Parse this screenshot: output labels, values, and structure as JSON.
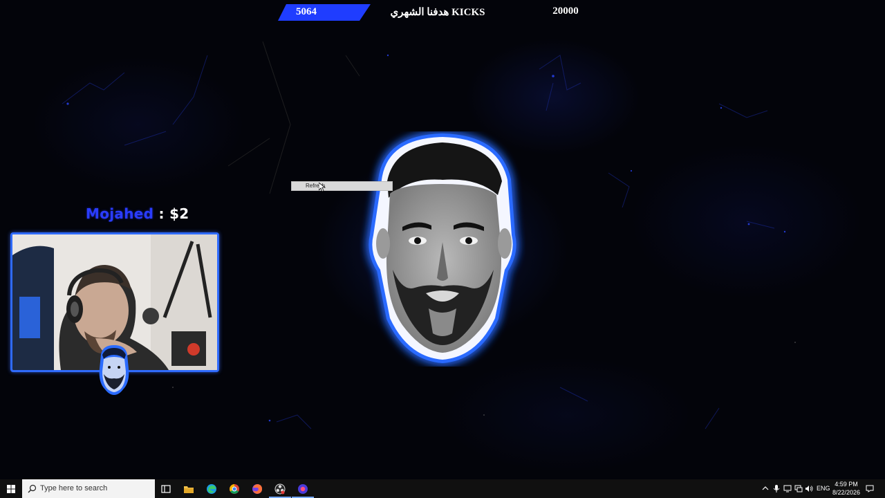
{
  "overlay": {
    "goal_current": "5064",
    "goal_title": "هدفنا الشهري KICKS",
    "goal_target": "20000",
    "accent_color": "#1f3dff"
  },
  "context_menu": {
    "item_label": "Refresh"
  },
  "donation_alert": {
    "name": "Mojahed",
    "separator": ":",
    "amount_fragment": "$2",
    "name_color": "#2a3cff"
  },
  "webcam": {
    "border_color": "#2f6bff"
  },
  "taskbar": {
    "search_placeholder": "Type here to search",
    "pinned_icons": [
      "task-view-icon",
      "file-explorer-icon",
      "edge-icon",
      "chrome-icon",
      "firefox-icon",
      "obs-icon",
      "streaming-app-icon"
    ],
    "tray": {
      "language": "ENG",
      "time": "4:59 PM",
      "date": "8/22/2026"
    }
  }
}
